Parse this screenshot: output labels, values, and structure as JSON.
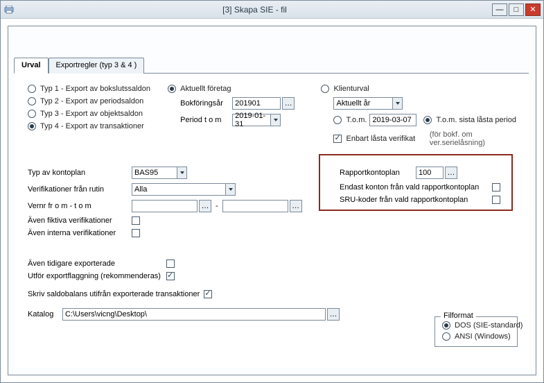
{
  "window": {
    "title": "[3]   Skapa SIE - fil"
  },
  "tabs": {
    "t1": "Urval",
    "t2": "Exportregler (typ 3 & 4 )"
  },
  "typeRadios": {
    "r1": "Typ 1 - Export av bokslutssaldon",
    "r2": "Typ 2 - Export av periodsaldon",
    "r3": "Typ 3 - Export av objektsaldon",
    "r4": "Typ 4 - Export av transaktioner"
  },
  "mid": {
    "aktuellt": "Aktuellt företag",
    "bokforingsar_label": "Bokföringsår",
    "bokforingsar_value": "201901",
    "period_label": "Period t o m",
    "period_value": "2019-01-31"
  },
  "right": {
    "klienturval": "Klienturval",
    "aktuellt_ar": "Aktuellt år",
    "tom_label": "T.o.m.",
    "tom_value": "2019-03-07",
    "tom_sista": "T.o.m. sista låsta period",
    "enbart": "Enbart låsta verifikat",
    "forbokf": "(för bokf. om ver.serielåsning)"
  },
  "kontoplan": {
    "label": "Typ av kontoplan",
    "value": "BAS95",
    "verif_label": "Verifikationer från rutin",
    "verif_value": "Alla",
    "vernr_label": "Vernr fr o m - t o m",
    "dash": "-",
    "fiktiva": "Även fiktiva verifikationer",
    "interna": "Även interna verifikationer"
  },
  "rapportbox": {
    "label": "Rapportkontoplan",
    "value": "100",
    "endast": "Endast konton från vald rapportkontoplan",
    "sru": "SRU-koder från vald rapportkontoplan"
  },
  "lower": {
    "tidigare": "Även tidigare exporterade",
    "flaggning": "Utför exportflaggning (rekommenderas)",
    "saldo": "Skriv saldobalans utifrån exporterade transaktioner",
    "katalog_label": "Katalog",
    "katalog_value": "C:\\Users\\vicng\\Desktop\\"
  },
  "filformat": {
    "legend": "Filformat",
    "dos": "DOS (SIE-standard)",
    "ansi": "ANSI (Windows)"
  },
  "icons": {
    "ellipsis": "…",
    "minimize": "—",
    "maximize": "□",
    "close": "✕"
  }
}
